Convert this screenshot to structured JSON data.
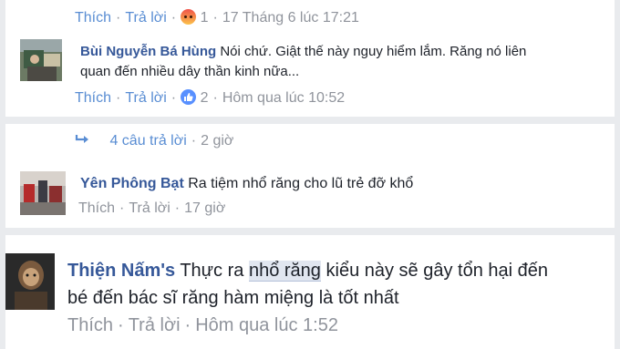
{
  "comment_top": {
    "like_label": "Thích",
    "reply_label": "Trả lời",
    "reaction_icon": "angry-reaction-icon",
    "reaction_count": "1",
    "timestamp": "17 Tháng 6 lúc 17:21"
  },
  "comment_hung": {
    "author": "Bùi Nguyễn Bá Hùng",
    "text_line1": "Nói chứ. Giật thế này nguy hiểm lắm. Răng nó liên",
    "text_line2": "quan đến nhiều dây thần kinh nữa...",
    "like_label": "Thích",
    "reply_label": "Trả lời",
    "reaction_icon": "like-reaction-icon",
    "reaction_count": "2",
    "timestamp": "Hôm qua lúc 10:52"
  },
  "replies_toggle": {
    "icon": "reply-arrow-icon",
    "label": "4 câu trả lời",
    "age": "2 giờ"
  },
  "comment_yen": {
    "author": "Yên Phông Bạt",
    "text": "Ra tiệm nhổ răng cho lũ trẻ đỡ khổ",
    "like_label": "Thích",
    "reply_label": "Trả lời",
    "timestamp": "17 giờ"
  },
  "comment_thien": {
    "author": "Thiện Nấm's",
    "text_before": "Thực ra",
    "text_highlight": "nhổ răng",
    "text_after": "kiểu này sẽ gây tổn hại đến",
    "text_line2": "bé đến bác sĩ răng hàm miệng là tốt nhất",
    "like_label": "Thích",
    "reply_label": "Trả lời",
    "timestamp": "Hôm qua lúc 1:52"
  },
  "colors": {
    "link_blue": "#598dd3",
    "name_blue": "#365899",
    "meta_grey": "#90949c",
    "text": "#1d2129",
    "background": "#e9ebee",
    "highlight": "#e1e6f0"
  }
}
